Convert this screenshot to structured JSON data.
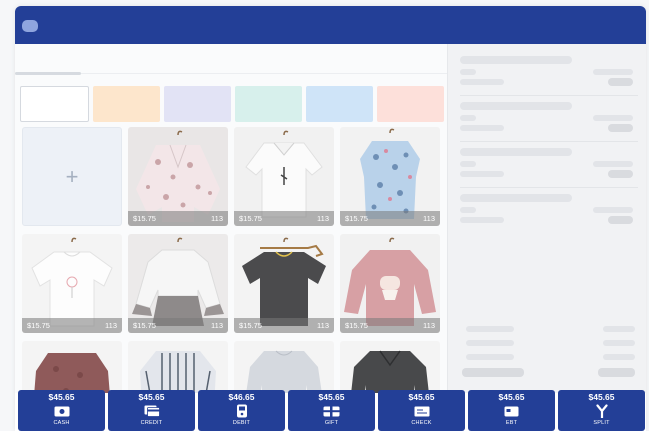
{
  "categories": [
    {
      "color": "#ffffff"
    },
    {
      "color": "#fde6cc"
    },
    {
      "color": "#e2e3f5"
    },
    {
      "color": "#d7f0ec"
    },
    {
      "color": "#cfe4f8"
    },
    {
      "color": "#fde0da"
    }
  ],
  "add_tile": {
    "glyph": "+"
  },
  "products": [
    {
      "price": "$15.75",
      "qty": "113",
      "garment": "kimono-floral"
    },
    {
      "price": "$15.75",
      "qty": "113",
      "garment": "white-shirt"
    },
    {
      "price": "$15.75",
      "qty": "113",
      "garment": "blue-floral-top"
    },
    {
      "price": "$15.75",
      "qty": "113",
      "garment": "white-tee"
    },
    {
      "price": "$15.75",
      "qty": "113",
      "garment": "ruffle-top"
    },
    {
      "price": "$15.75",
      "qty": "113",
      "garment": "grey-tee"
    },
    {
      "price": "$15.75",
      "qty": "113",
      "garment": "pink-sweatshirt"
    },
    {
      "price": "",
      "qty": "",
      "garment": "burgundy-blouse"
    },
    {
      "price": "",
      "qty": "",
      "garment": "stripe-top"
    },
    {
      "price": "",
      "qty": "",
      "garment": "grey-longsleeve"
    },
    {
      "price": "",
      "qty": "",
      "garment": "charcoal-sweater"
    }
  ],
  "payments": [
    {
      "amount": "$45.65",
      "label": "CASH",
      "icon": "cash-icon"
    },
    {
      "amount": "$45.65",
      "label": "CREDIT",
      "icon": "credit-card-icon"
    },
    {
      "amount": "$46.65",
      "label": "DEBIT",
      "icon": "debit-icon"
    },
    {
      "amount": "$45.65",
      "label": "GIFT",
      "icon": "gift-card-icon"
    },
    {
      "amount": "$45.65",
      "label": "CHECK",
      "icon": "check-icon"
    },
    {
      "amount": "$45.65",
      "label": "EBT",
      "icon": "ebt-icon"
    },
    {
      "amount": "$45.65",
      "label": "SPLIT",
      "icon": "split-icon"
    }
  ],
  "colors": {
    "brand": "#233f97",
    "menu_pill": "#8fa5de"
  }
}
